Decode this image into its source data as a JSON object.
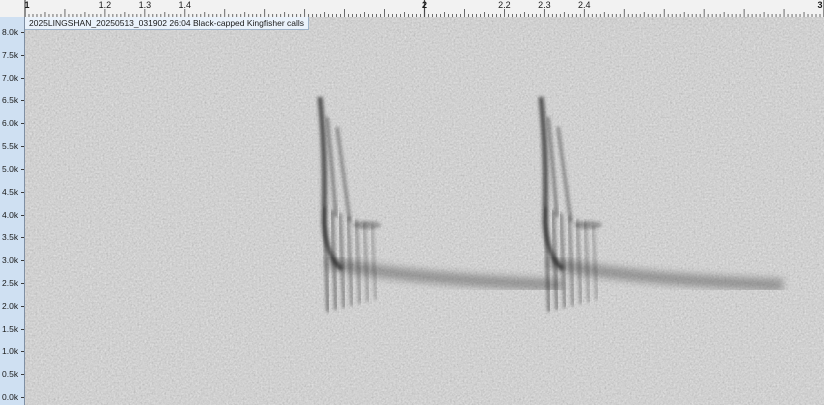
{
  "time_ruler": {
    "labels": [
      {
        "text": "1",
        "value": 1.0,
        "major": true
      },
      {
        "text": "1.2",
        "value": 1.2,
        "major": false
      },
      {
        "text": "1.3",
        "value": 1.3,
        "major": false
      },
      {
        "text": "1.4",
        "value": 1.4,
        "major": false
      },
      {
        "text": "2",
        "value": 2.0,
        "major": true
      },
      {
        "text": "2.2",
        "value": 2.2,
        "major": false
      },
      {
        "text": "2.3",
        "value": 2.3,
        "major": false
      },
      {
        "text": "2.4",
        "value": 2.4,
        "major": false
      },
      {
        "text": "3",
        "value": 3.0,
        "major": true
      }
    ]
  },
  "freq_ruler": {
    "labels": [
      "8.0k",
      "7.5k",
      "7.0k",
      "6.5k",
      "6.0k",
      "5.5k",
      "5.0k",
      "4.5k",
      "4.0k",
      "3.5k",
      "3.0k",
      "2.5k",
      "2.0k",
      "1.5k",
      "1.0k",
      "0.5k",
      "0.0k"
    ],
    "values": [
      8.0,
      7.5,
      7.0,
      6.5,
      6.0,
      5.5,
      5.0,
      4.5,
      4.0,
      3.5,
      3.0,
      2.5,
      2.0,
      1.5,
      1.0,
      0.5,
      0.0
    ]
  },
  "clip": {
    "title": "2025LINGSHAN_20250513_031902 26:04 Black-capped Kingfisher calls"
  },
  "colors": {
    "spectrogram_bg": "#c6c6c6",
    "call_ink": "#2a2a2a",
    "ruler_bg": "#cfe0f2"
  }
}
